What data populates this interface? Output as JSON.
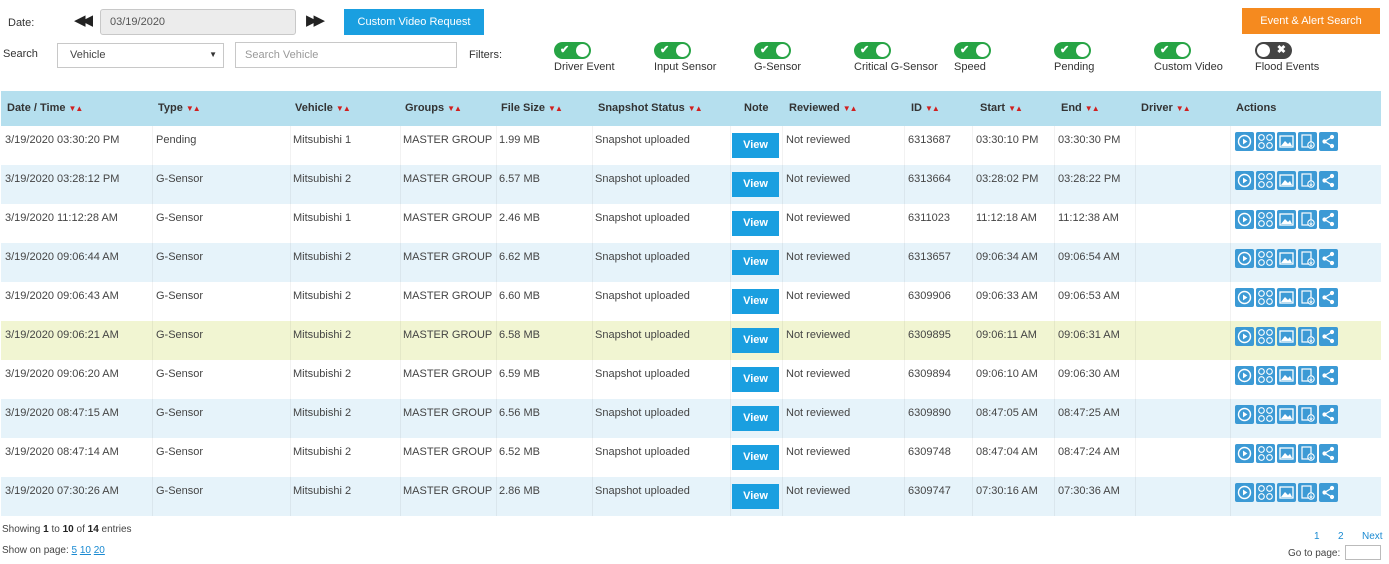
{
  "toolbar": {
    "date_label": "Date:",
    "date_value": "03/19/2020",
    "prev_icon": "double-left-arrow-icon",
    "next_icon": "double-right-arrow-icon",
    "custom_video_label": "Custom Video Request",
    "event_alert_label": "Event & Alert Search",
    "search_label": "Search",
    "search_type_selected": "Vehicle",
    "search_placeholder": "Search Vehicle",
    "filters_label": "Filters:"
  },
  "filters": [
    {
      "label": "Driver Event",
      "on": true
    },
    {
      "label": "Input Sensor",
      "on": true
    },
    {
      "label": "G-Sensor",
      "on": true
    },
    {
      "label": "Critical G-Sensor",
      "on": true
    },
    {
      "label": "Speed",
      "on": true
    },
    {
      "label": "Pending",
      "on": true
    },
    {
      "label": "Custom Video",
      "on": true
    },
    {
      "label": "Flood Events",
      "on": false
    }
  ],
  "table": {
    "columns": [
      "Date / Time",
      "Type",
      "Vehicle",
      "Groups",
      "File Size",
      "Snapshot Status",
      "Note",
      "Reviewed",
      "ID",
      "Start",
      "End",
      "Driver",
      "Actions"
    ],
    "view_label": "View",
    "action_icons": [
      "play-icon",
      "grid-icon",
      "image-icon",
      "download-icon",
      "share-icon"
    ],
    "rows": [
      {
        "datetime": "3/19/2020 03:30:20 PM",
        "type": "Pending",
        "vehicle": "Mitsubishi 1",
        "group": "MASTER GROUP",
        "size": "1.99 MB",
        "snapshot": "Snapshot uploaded",
        "reviewed": "Not reviewed",
        "id": "6313687",
        "start": "03:30:10 PM",
        "end": "03:30:30 PM",
        "driver": ""
      },
      {
        "datetime": "3/19/2020 03:28:12 PM",
        "type": "G-Sensor",
        "vehicle": "Mitsubishi 2",
        "group": "MASTER GROUP",
        "size": "6.57 MB",
        "snapshot": "Snapshot uploaded",
        "reviewed": "Not reviewed",
        "id": "6313664",
        "start": "03:28:02 PM",
        "end": "03:28:22 PM",
        "driver": ""
      },
      {
        "datetime": "3/19/2020 11:12:28 AM",
        "type": "G-Sensor",
        "vehicle": "Mitsubishi 1",
        "group": "MASTER GROUP",
        "size": "2.46 MB",
        "snapshot": "Snapshot uploaded",
        "reviewed": "Not reviewed",
        "id": "6311023",
        "start": "11:12:18 AM",
        "end": "11:12:38 AM",
        "driver": ""
      },
      {
        "datetime": "3/19/2020 09:06:44 AM",
        "type": "G-Sensor",
        "vehicle": "Mitsubishi 2",
        "group": "MASTER GROUP",
        "size": "6.62 MB",
        "snapshot": "Snapshot uploaded",
        "reviewed": "Not reviewed",
        "id": "6313657",
        "start": "09:06:34 AM",
        "end": "09:06:54 AM",
        "driver": ""
      },
      {
        "datetime": "3/19/2020 09:06:43 AM",
        "type": "G-Sensor",
        "vehicle": "Mitsubishi 2",
        "group": "MASTER GROUP",
        "size": "6.60 MB",
        "snapshot": "Snapshot uploaded",
        "reviewed": "Not reviewed",
        "id": "6309906",
        "start": "09:06:33 AM",
        "end": "09:06:53 AM",
        "driver": ""
      },
      {
        "datetime": "3/19/2020 09:06:21 AM",
        "type": "G-Sensor",
        "vehicle": "Mitsubishi 2",
        "group": "MASTER GROUP",
        "size": "6.58 MB",
        "snapshot": "Snapshot uploaded",
        "reviewed": "Not reviewed",
        "id": "6309895",
        "start": "09:06:11 AM",
        "end": "09:06:31 AM",
        "driver": ""
      },
      {
        "datetime": "3/19/2020 09:06:20 AM",
        "type": "G-Sensor",
        "vehicle": "Mitsubishi 2",
        "group": "MASTER GROUP",
        "size": "6.59 MB",
        "snapshot": "Snapshot uploaded",
        "reviewed": "Not reviewed",
        "id": "6309894",
        "start": "09:06:10 AM",
        "end": "09:06:30 AM",
        "driver": ""
      },
      {
        "datetime": "3/19/2020 08:47:15 AM",
        "type": "G-Sensor",
        "vehicle": "Mitsubishi 2",
        "group": "MASTER GROUP",
        "size": "6.56 MB",
        "snapshot": "Snapshot uploaded",
        "reviewed": "Not reviewed",
        "id": "6309890",
        "start": "08:47:05 AM",
        "end": "08:47:25 AM",
        "driver": ""
      },
      {
        "datetime": "3/19/2020 08:47:14 AM",
        "type": "G-Sensor",
        "vehicle": "Mitsubishi 2",
        "group": "MASTER GROUP",
        "size": "6.52 MB",
        "snapshot": "Snapshot uploaded",
        "reviewed": "Not reviewed",
        "id": "6309748",
        "start": "08:47:04 AM",
        "end": "08:47:24 AM",
        "driver": ""
      },
      {
        "datetime": "3/19/2020 07:30:26 AM",
        "type": "G-Sensor",
        "vehicle": "Mitsubishi 2",
        "group": "MASTER GROUP",
        "size": "2.86 MB",
        "snapshot": "Snapshot uploaded",
        "reviewed": "Not reviewed",
        "id": "6309747",
        "start": "07:30:16 AM",
        "end": "07:30:36 AM",
        "driver": ""
      }
    ]
  },
  "footer": {
    "showing_prefix": "Showing",
    "from": "1",
    "to_word": "to",
    "to": "10",
    "of_word": "of",
    "total": "14",
    "entries_word": "entries",
    "page_size_label": "Show on page:",
    "page_sizes": [
      "5",
      "10",
      "20"
    ],
    "pages": [
      "1",
      "2"
    ],
    "next_label": "Next",
    "goto_label": "Go to page:"
  },
  "colors": {
    "accent_blue": "#1a9fe0",
    "accent_orange": "#f58a1f",
    "toggle_on": "#27a445",
    "toggle_off": "#444444",
    "header_bg": "#b5dfee",
    "row_alt_bg": "#e6f3fa",
    "row_highlight_bg": "#f1f5d2",
    "sort_arrow": "#d02020"
  }
}
